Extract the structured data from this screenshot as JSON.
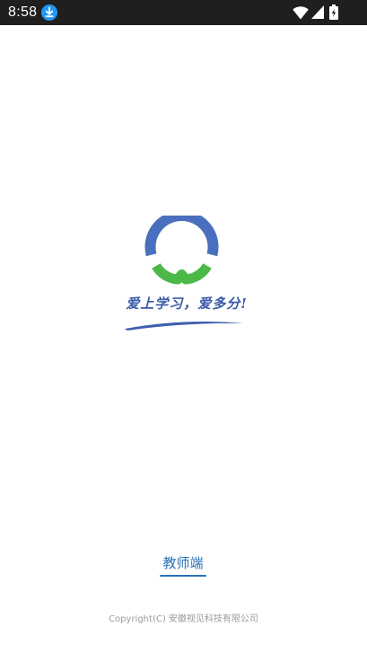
{
  "status_bar": {
    "time": "8:58",
    "icons": [
      "download-icon",
      "wifi-icon",
      "signal-icon",
      "battery-icon"
    ]
  },
  "splash": {
    "slogan": "爱上学习，爱多分!",
    "role_button_label": "教师端",
    "copyright": "Copyright(C) 安徽视见科技有限公司"
  },
  "colors": {
    "status_bar_bg": "#1f1f1f",
    "logo_blue": "#4a6fbe",
    "logo_green": "#4cb848",
    "download_badge": "#2196f3",
    "slogan_text": "#3a5aa8",
    "role_button_text": "#2a6fb5",
    "copyright_text": "#9a9a9a"
  }
}
